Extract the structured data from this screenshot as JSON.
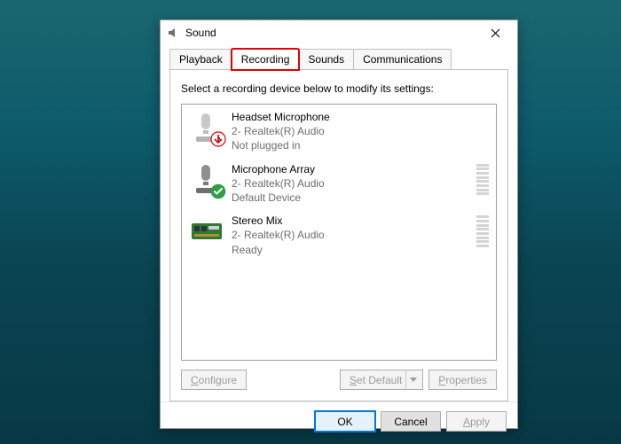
{
  "dialog": {
    "title": "Sound",
    "close": "Close"
  },
  "tabs": {
    "playback": "Playback",
    "recording": "Recording",
    "sounds": "Sounds",
    "communications": "Communications"
  },
  "instruction": "Select a recording device below to modify its settings:",
  "devices": [
    {
      "name": "Headset Microphone",
      "driver": "2- Realtek(R) Audio",
      "status": "Not plugged in",
      "icon": "headset-mic",
      "badge": "unplugged"
    },
    {
      "name": "Microphone Array",
      "driver": "2- Realtek(R) Audio",
      "status": "Default Device",
      "icon": "mic",
      "badge": "default"
    },
    {
      "name": "Stereo Mix",
      "driver": "2- Realtek(R) Audio",
      "status": "Ready",
      "icon": "soundcard",
      "badge": "none"
    }
  ],
  "buttons": {
    "configure": "Configure",
    "set_default": "Set Default",
    "properties": "Properties",
    "ok": "OK",
    "cancel": "Cancel",
    "apply": "Apply"
  },
  "underlines": {
    "configure": "C",
    "set_default": "S",
    "properties": "P",
    "apply": "A"
  }
}
